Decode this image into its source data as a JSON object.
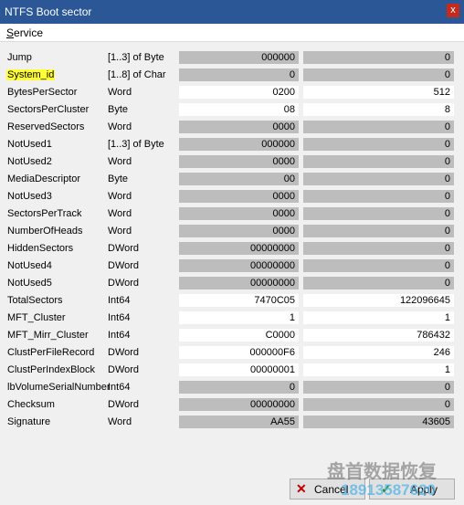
{
  "window": {
    "title": "NTFS Boot sector",
    "close_glyph": "x"
  },
  "menu": {
    "service_first": "S",
    "service_rest": "ervice"
  },
  "rows": [
    {
      "name": "Jump",
      "type": "[1..3] of Byte",
      "hex": "000000",
      "dec": "0"
    },
    {
      "name": "System_id",
      "type": "[1..8] of Char",
      "hex": "0",
      "dec": "0"
    },
    {
      "name": "BytesPerSector",
      "type": "Word",
      "hex": "0200",
      "dec": "512"
    },
    {
      "name": "SectorsPerCluster",
      "type": "Byte",
      "hex": "08",
      "dec": "8"
    },
    {
      "name": "ReservedSectors",
      "type": "Word",
      "hex": "0000",
      "dec": "0"
    },
    {
      "name": "NotUsed1",
      "type": "[1..3] of Byte",
      "hex": "000000",
      "dec": "0"
    },
    {
      "name": "NotUsed2",
      "type": "Word",
      "hex": "0000",
      "dec": "0"
    },
    {
      "name": "MediaDescriptor",
      "type": "Byte",
      "hex": "00",
      "dec": "0"
    },
    {
      "name": "NotUsed3",
      "type": "Word",
      "hex": "0000",
      "dec": "0"
    },
    {
      "name": "SectorsPerTrack",
      "type": "Word",
      "hex": "0000",
      "dec": "0"
    },
    {
      "name": "NumberOfHeads",
      "type": "Word",
      "hex": "0000",
      "dec": "0"
    },
    {
      "name": "HiddenSectors",
      "type": "DWord",
      "hex": "00000000",
      "dec": "0"
    },
    {
      "name": "NotUsed4",
      "type": "DWord",
      "hex": "00000000",
      "dec": "0"
    },
    {
      "name": "NotUsed5",
      "type": "DWord",
      "hex": "00000000",
      "dec": "0"
    },
    {
      "name": "TotalSectors",
      "type": "Int64",
      "hex": "7470C05",
      "dec": "122096645"
    },
    {
      "name": "MFT_Cluster",
      "type": "Int64",
      "hex": "1",
      "dec": "1"
    },
    {
      "name": "MFT_Mirr_Cluster",
      "type": "Int64",
      "hex": "C0000",
      "dec": "786432"
    },
    {
      "name": "ClustPerFileRecord",
      "type": "DWord",
      "hex": "000000F6",
      "dec": "246"
    },
    {
      "name": "ClustPerIndexBlock",
      "type": "DWord",
      "hex": "00000001",
      "dec": "1"
    },
    {
      "name": "lbVolumeSerialNumber",
      "type": "Int64",
      "hex": "0",
      "dec": "0"
    },
    {
      "name": "Checksum",
      "type": "DWord",
      "hex": "00000000",
      "dec": "0"
    },
    {
      "name": "Signature",
      "type": "Word",
      "hex": "AA55",
      "dec": "43605"
    }
  ],
  "highlighted_row": "System_id",
  "editable_rows": [
    "BytesPerSector",
    "SectorsPerCluster",
    "TotalSectors",
    "MFT_Cluster",
    "MFT_Mirr_Cluster",
    "ClustPerFileRecord",
    "ClustPerIndexBlock"
  ],
  "buttons": {
    "cancel": "Cancel",
    "apply": "Apply",
    "cancel_icon": "x-icon",
    "apply_icon": "check-icon"
  },
  "watermark": {
    "line1": "盘首数据恢复",
    "line2": "18913587620"
  },
  "colors": {
    "titlebar": "#2b5797",
    "close": "#c42b1c",
    "highlight": "#ffff33",
    "readonly_field": "#bdbdbd"
  }
}
